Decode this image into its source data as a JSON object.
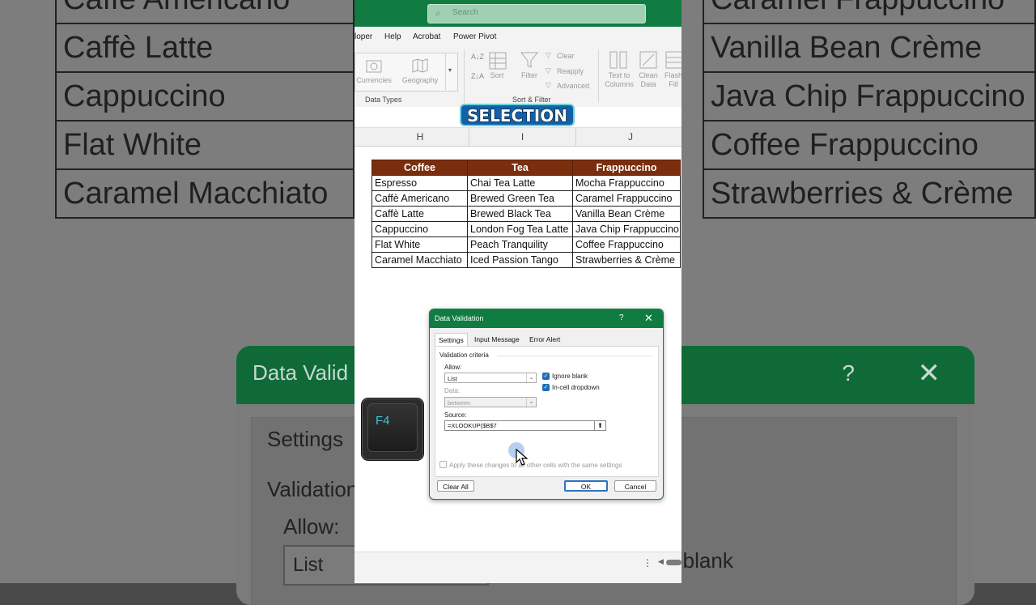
{
  "background": {
    "left_items": [
      "Caffè Americano",
      "Caffè Latte",
      "Cappuccino",
      "Flat White",
      "Caramel Macchiato"
    ],
    "right_items": [
      "Caramel Frappuccino",
      "Vanilla Bean Crème",
      "Java Chip Frappuccino",
      "Coffee Frappuccino",
      "Strawberries & Crème"
    ],
    "dialog": {
      "title": "Data Valid",
      "help": "?",
      "close": "✕",
      "settings": "Settings",
      "criteria": "Validation",
      "allow": "Allow:",
      "list": "List",
      "blank": "e blank"
    }
  },
  "search": {
    "placeholder": "Search"
  },
  "menu": [
    "loper",
    "Help",
    "Acrobat",
    "Power Pivot"
  ],
  "ribbon": {
    "currencies": "Currencies",
    "geography": "Geography",
    "data_types": "Data Types",
    "sort": "Sort",
    "filter": "Filter",
    "clear": "Clear",
    "reapply": "Reapply",
    "advanced": "Advanced",
    "sort_filter": "Sort & Filter",
    "text_to_columns": "Text to Columns",
    "clean_data": "Clean Data",
    "flash_fill": "Flash Fill"
  },
  "overlay_label": "SELECTION",
  "columns": [
    "H",
    "I",
    "J"
  ],
  "menu_table": {
    "headers": [
      "Coffee",
      "Tea",
      "Frappuccino"
    ],
    "rows": [
      [
        "Espresso",
        "Chai Tea Latte",
        "Mocha Frappuccino"
      ],
      [
        "Caffè Americano",
        "Brewed Green Tea",
        "Caramel Frappuccino"
      ],
      [
        "Caffè Latte",
        "Brewed Black Tea",
        "Vanilla Bean Crème"
      ],
      [
        "Cappuccino",
        "London Fog Tea Latte",
        "Java Chip Frappuccino"
      ],
      [
        "Flat White",
        "Peach Tranquility",
        "Coffee Frappuccino"
      ],
      [
        "Caramel Macchiato",
        "Iced Passion Tango",
        "Strawberries & Crème"
      ]
    ]
  },
  "dialog": {
    "title": "Data Validation",
    "help": "?",
    "close": "✕",
    "tabs": [
      "Settings",
      "Input Message",
      "Error Alert"
    ],
    "criteria_label": "Validation criteria",
    "allow_label": "Allow:",
    "allow_value": "List",
    "ignore_blank": "Ignore blank",
    "in_cell_dropdown": "In-cell dropdown",
    "data_label": "Data:",
    "data_value": "between",
    "source_label": "Source:",
    "source_value": "=XLOOKUP($B$7",
    "apply_all": "Apply these changes to all other cells with the same settings",
    "clear_all": "Clear All",
    "ok": "OK",
    "cancel": "Cancel"
  },
  "key_overlay": "F4",
  "colors": {
    "excel_green": "#107c41",
    "header_brown": "#7a2e0d",
    "selection_blue": "#1261a8",
    "key_cyan": "#3fc6e0"
  }
}
